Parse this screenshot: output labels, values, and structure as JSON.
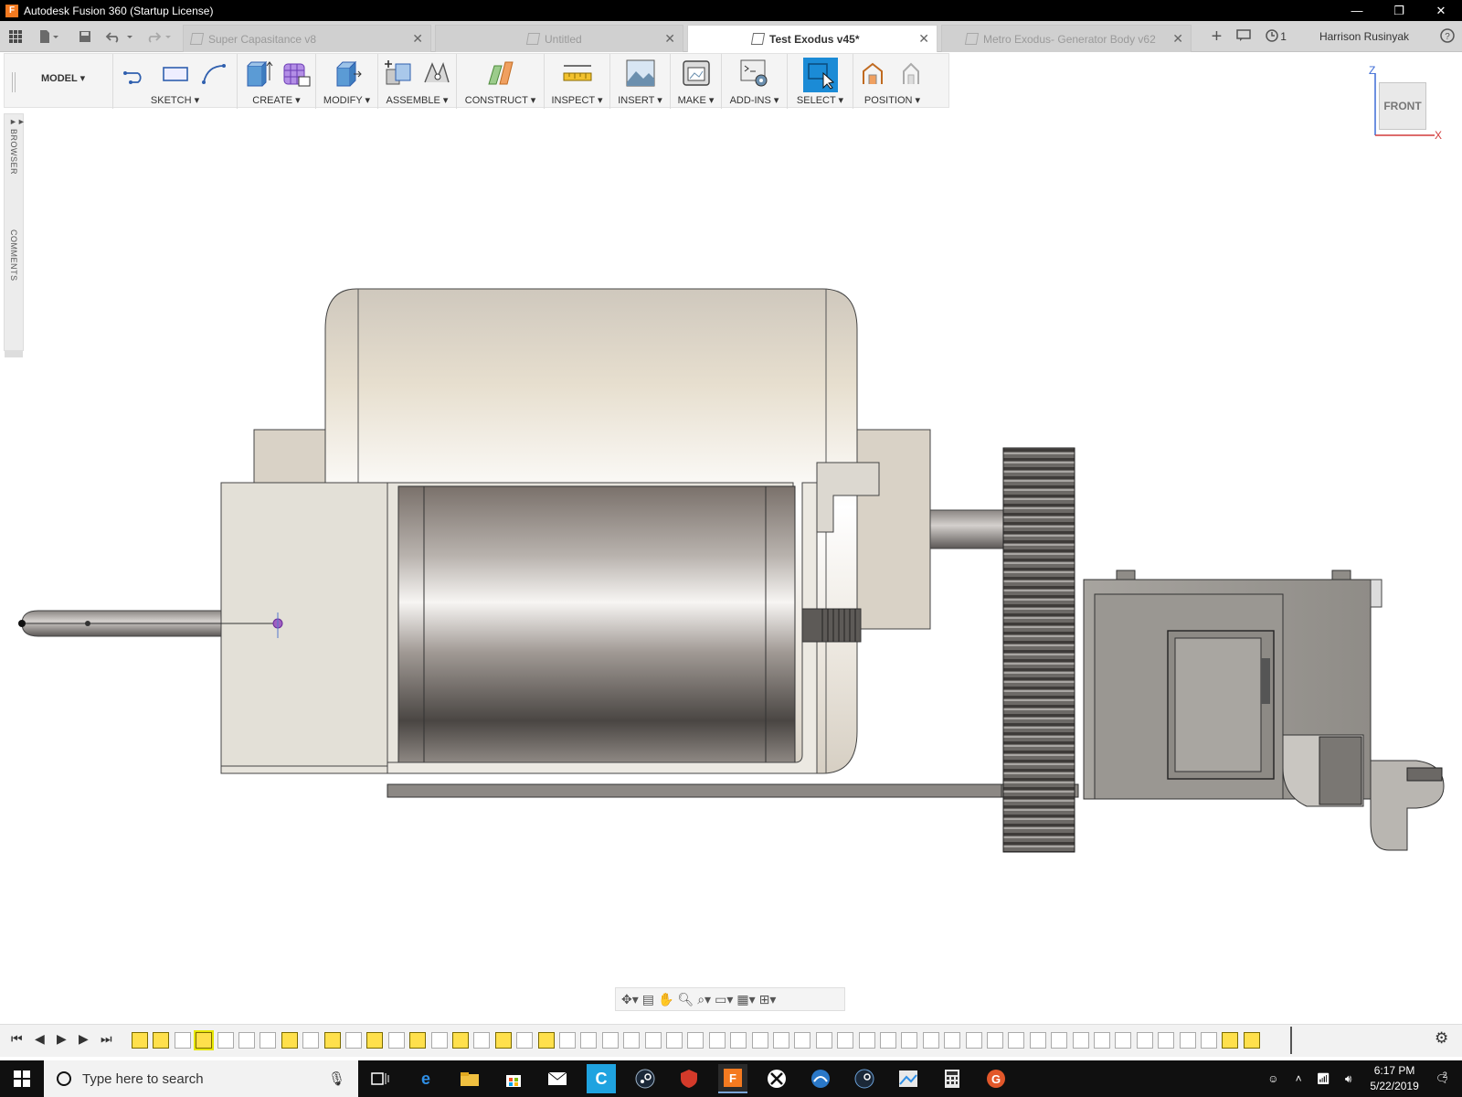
{
  "window": {
    "title": "Autodesk Fusion 360 (Startup License)",
    "app_icon_letter": "F",
    "minimize": "—",
    "restore": "❐",
    "close": "✕"
  },
  "tabs": [
    {
      "label": "Super Capasitance v8",
      "active": false
    },
    {
      "label": "Untitled",
      "active": false
    },
    {
      "label": "Test Exodus v45*",
      "active": true
    },
    {
      "label": "Metro Exodus- Generator Body v62",
      "active": false
    }
  ],
  "tabbar": {
    "new_tab": "+",
    "job_count": "1",
    "user_name": "Harrison Rusinyak",
    "help": "?"
  },
  "toolbar": {
    "workspace": "MODEL ▾",
    "groups": [
      {
        "label": "SKETCH ▾"
      },
      {
        "label": "CREATE ▾"
      },
      {
        "label": "MODIFY ▾"
      },
      {
        "label": "ASSEMBLE ▾"
      },
      {
        "label": "CONSTRUCT ▾"
      },
      {
        "label": "INSPECT ▾"
      },
      {
        "label": "INSERT ▾"
      },
      {
        "label": "MAKE ▾"
      },
      {
        "label": "ADD-INS ▾"
      },
      {
        "label": "SELECT ▾"
      },
      {
        "label": "POSITION ▾"
      }
    ]
  },
  "viewcube": {
    "face": "FRONT",
    "axis_z": "Z",
    "axis_x": "X"
  },
  "side_panel": {
    "browser": "BROWSER",
    "comments": "COMMENTS"
  },
  "timeline": {
    "controls": [
      "⏮",
      "◀",
      "▶",
      "▶",
      "⏭"
    ],
    "settings": "⚙"
  },
  "taskbar": {
    "search_placeholder": "Type here to search",
    "time": "6:17 PM",
    "date": "5/22/2019",
    "notifications": "2"
  },
  "colors": {
    "accent_blue": "#1b8bd6",
    "fusion_orange": "#f47a20",
    "taskbar": "#101010"
  }
}
